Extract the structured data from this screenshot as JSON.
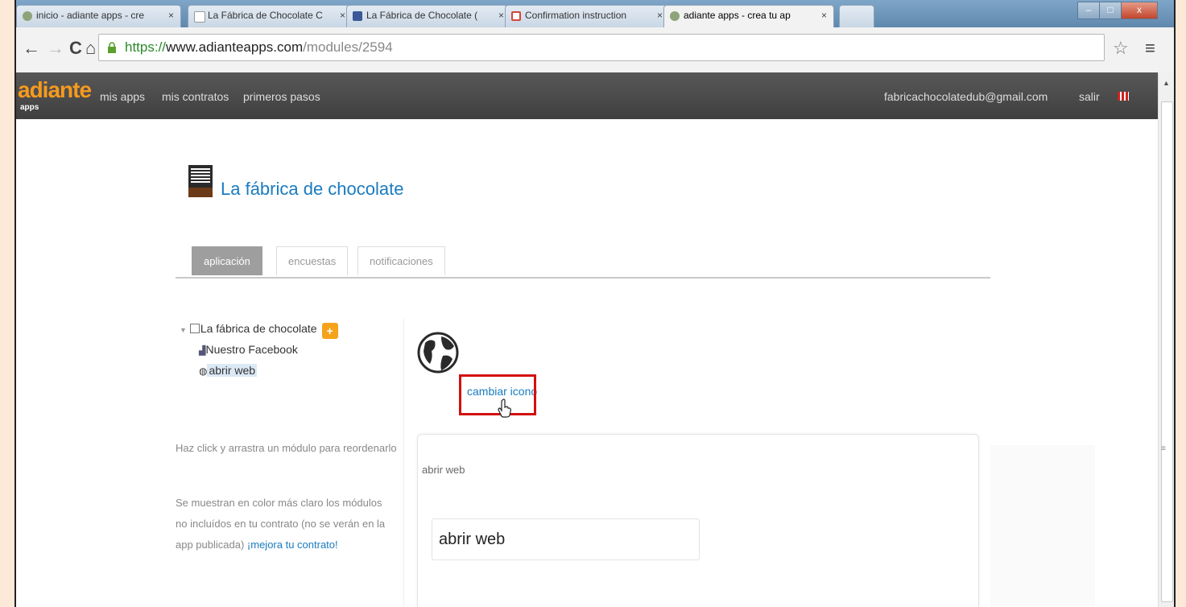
{
  "browser": {
    "tabs": [
      {
        "title": "inicio - adiante apps - cre",
        "icon_color": "#8fa37a",
        "active": false
      },
      {
        "title": "La Fábrica de Chocolate C",
        "icon_color": "#ffffff",
        "active": false
      },
      {
        "title": "La Fábrica de Chocolate (",
        "icon_color": "#3b5998",
        "active": false
      },
      {
        "title": "Confirmation instruction",
        "icon_color": "#d44638",
        "active": false
      },
      {
        "title": "adiante apps - crea tu ap",
        "icon_color": "#8fa37a",
        "active": true
      }
    ],
    "tab_close": "×",
    "window_buttons": [
      "–",
      "□",
      "x"
    ],
    "nav": {
      "back": "←",
      "forward": "→",
      "reload": "C",
      "home": "⌂"
    },
    "url": {
      "protocol": "https://",
      "host": "www.adianteapps.com",
      "path": "/modules/2594"
    },
    "bookmark_star": "☆",
    "menu": "≡"
  },
  "header": {
    "logo": "adiante",
    "logo_sub": "apps",
    "nav": [
      "mis apps",
      "mis contratos",
      "primeros pasos"
    ],
    "email": "fabricachocolatedub@gmail.com",
    "logout": "salir"
  },
  "app": {
    "title": "La fábrica de chocolate",
    "tabs": [
      "aplicación",
      "encuestas",
      "notificaciones"
    ],
    "active_tab": "aplicación"
  },
  "tree": {
    "root": "La fábrica de chocolate",
    "add": "+",
    "children": [
      "Nuestro Facebook",
      "abrir web"
    ],
    "selected": "abrir web"
  },
  "help": {
    "reorder": "Haz click y arrastra un módulo para reordenarlo",
    "lighter_line1": "Se muestran en color más claro los módulos",
    "lighter_line2": "no incluídos en tu contrato (no se verán en la",
    "lighter_line3": "app publicada)",
    "upgrade_link": "¡mejora tu contrato!"
  },
  "module": {
    "change_icon": "cambiar icono",
    "name_label": "abrir web",
    "name_value": "abrir web"
  },
  "colors": {
    "accent": "#1a7bbf",
    "brand": "#f59a1e",
    "highlight": "#d31010"
  }
}
